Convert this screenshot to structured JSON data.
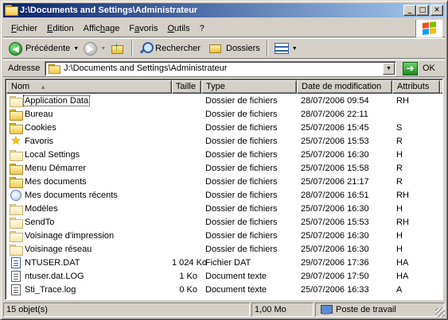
{
  "window": {
    "title": "J:\\Documents and Settings\\Administrateur",
    "buttons": {
      "minimize": "_",
      "maximize": "□",
      "close": "✕"
    }
  },
  "menubar": {
    "items": [
      {
        "label": "Fichier",
        "key": "F"
      },
      {
        "label": "Edition",
        "key": "E"
      },
      {
        "label": "Affichage",
        "key": "h"
      },
      {
        "label": "Favoris",
        "key": "a"
      },
      {
        "label": "Outils",
        "key": "O"
      },
      {
        "label": "?",
        "key": "?"
      }
    ]
  },
  "toolbar": {
    "back_label": "Précédente",
    "search_label": "Rechercher",
    "folders_label": "Dossiers"
  },
  "address": {
    "label": "Adresse",
    "value": "J:\\Documents and Settings\\Administrateur",
    "go_label": "OK"
  },
  "list": {
    "columns": {
      "name": "Nom",
      "size": "Taille",
      "type": "Type",
      "date": "Date de modification",
      "attr": "Attributs"
    },
    "rows": [
      {
        "icon": "folder-pale",
        "name": "Application Data",
        "size": "",
        "type": "Dossier de fichiers",
        "date": "28/07/2006 09:54",
        "attr": "RH"
      },
      {
        "icon": "folder",
        "name": "Bureau",
        "size": "",
        "type": "Dossier de fichiers",
        "date": "28/07/2006 22:11",
        "attr": ""
      },
      {
        "icon": "folder",
        "name": "Cookies",
        "size": "",
        "type": "Dossier de fichiers",
        "date": "25/07/2006 15:45",
        "attr": "S"
      },
      {
        "icon": "star",
        "name": "Favoris",
        "size": "",
        "type": "Dossier de fichiers",
        "date": "25/07/2006 15:53",
        "attr": "R"
      },
      {
        "icon": "folder-pale",
        "name": "Local Settings",
        "size": "",
        "type": "Dossier de fichiers",
        "date": "25/07/2006 16:30",
        "attr": "H"
      },
      {
        "icon": "folder",
        "name": "Menu Démarrer",
        "size": "",
        "type": "Dossier de fichiers",
        "date": "25/07/2006 15:58",
        "attr": "R"
      },
      {
        "icon": "folder",
        "name": "Mes documents",
        "size": "",
        "type": "Dossier de fichiers",
        "date": "25/07/2006 21:17",
        "attr": "R"
      },
      {
        "icon": "recent",
        "name": "Mes documents récents",
        "size": "",
        "type": "Dossier de fichiers",
        "date": "28/07/2006 16:51",
        "attr": "RH"
      },
      {
        "icon": "folder-pale",
        "name": "Modèles",
        "size": "",
        "type": "Dossier de fichiers",
        "date": "25/07/2006 16:30",
        "attr": "H"
      },
      {
        "icon": "folder-pale",
        "name": "SendTo",
        "size": "",
        "type": "Dossier de fichiers",
        "date": "25/07/2006 15:53",
        "attr": "RH"
      },
      {
        "icon": "folder-pale",
        "name": "Voisinage d'impression",
        "size": "",
        "type": "Dossier de fichiers",
        "date": "25/07/2006 16:30",
        "attr": "H"
      },
      {
        "icon": "folder-pale",
        "name": "Voisinage réseau",
        "size": "",
        "type": "Dossier de fichiers",
        "date": "25/07/2006 16:30",
        "attr": "H"
      },
      {
        "icon": "dat",
        "name": "NTUSER.DAT",
        "size": "1 024 Ko",
        "type": "Fichier DAT",
        "date": "29/07/2006 17:36",
        "attr": "HA"
      },
      {
        "icon": "file",
        "name": "ntuser.dat.LOG",
        "size": "1 Ko",
        "type": "Document texte",
        "date": "29/07/2006 17:50",
        "attr": "HA"
      },
      {
        "icon": "file",
        "name": "Sti_Trace.log",
        "size": "0 Ko",
        "type": "Document texte",
        "date": "25/07/2006 16:33",
        "attr": "A"
      }
    ]
  },
  "status": {
    "count": "15 objet(s)",
    "size": "1,00 Mo",
    "location": "Poste de travail"
  }
}
